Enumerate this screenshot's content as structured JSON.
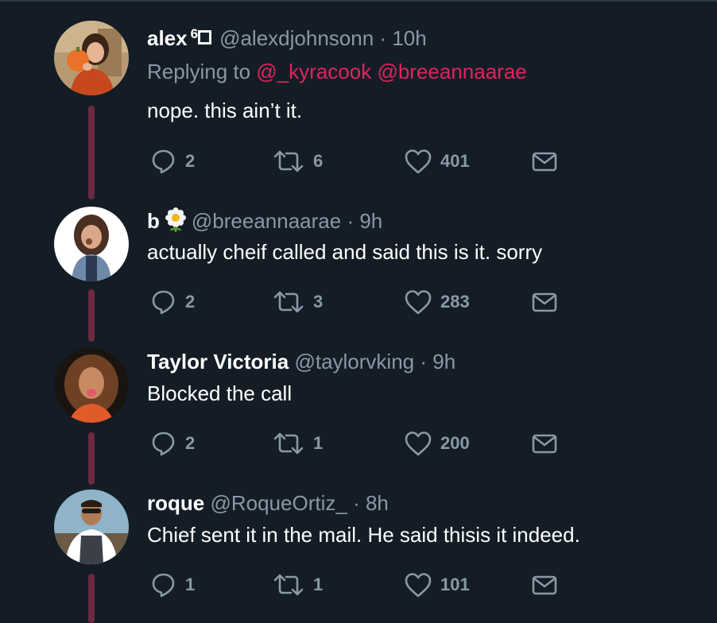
{
  "tweets": [
    {
      "name": "alex",
      "name_suffix": "6",
      "handle": "@alexdjohnsonn",
      "separator": "·",
      "time": "10h",
      "replying_prefix": "Replying to",
      "replying_to": [
        "@_kyracook",
        "@breeannaarae"
      ],
      "text": "nope. this ain’t it.",
      "replies": "2",
      "retweets": "6",
      "likes": "401"
    },
    {
      "name": "b",
      "name_emoji": "daisy-flower",
      "handle": "@breeannaarae",
      "separator": "·",
      "time": "9h",
      "text": "actually cheif called and said this is it. sorry",
      "replies": "2",
      "retweets": "3",
      "likes": "283"
    },
    {
      "name": "Taylor Victoria",
      "handle": "@taylorvking",
      "separator": "·",
      "time": "9h",
      "text": "Blocked the call",
      "replies": "2",
      "retweets": "1",
      "likes": "200"
    },
    {
      "name": "roque",
      "handle": "@RoqueOrtiz_",
      "separator": "·",
      "time": "8h",
      "text": "Chief sent it in the mail. He said thisis it indeed.",
      "replies": "1",
      "retweets": "1",
      "likes": "101"
    }
  ],
  "colors": {
    "background": "#141d26",
    "secondary_text": "#8899a6",
    "mention": "#e0245e",
    "thread_line": "#6b2a3f"
  },
  "icons": [
    "reply-icon",
    "retweet-icon",
    "like-icon",
    "direct-message-icon"
  ]
}
